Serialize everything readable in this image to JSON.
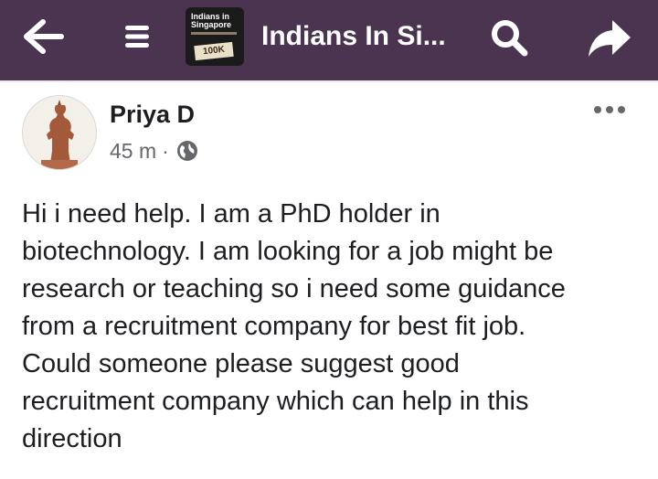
{
  "header": {
    "group_title": "Indians In Si...",
    "logo_text_line1": "Indians in Singapore",
    "logo_badge": "100K",
    "background_color": "#4a3450",
    "icons": [
      "arrow-left-icon",
      "menu-icon",
      "search-icon",
      "share-icon"
    ]
  },
  "post": {
    "author": "Priya D",
    "time": "45 m",
    "separator": "·",
    "privacy_icon": "globe-icon",
    "more_icon": "more-horizontal-icon",
    "text_lines": [
      "Hi i need help. I am a PhD holder in",
      "biotechnology. I am looking for a job might be",
      "research or teaching so i need some guidance",
      "from a recruitment company for best fit job.",
      "Could someone please suggest good",
      "recruitment company which can help in this",
      "direction"
    ]
  }
}
